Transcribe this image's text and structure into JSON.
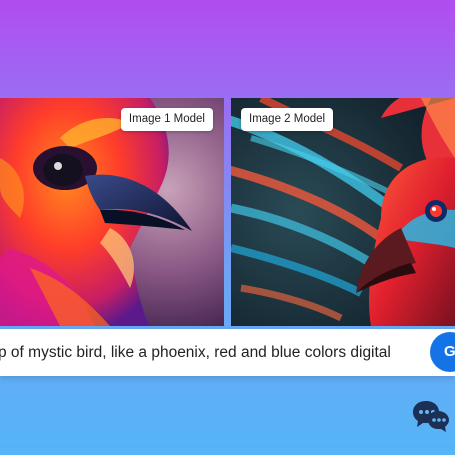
{
  "cards": [
    {
      "label": "Image 1 Model"
    },
    {
      "label": "Image 2 Model"
    }
  ],
  "prompt": {
    "text": "p of mystic bird, like a phoenix, red and blue colors digital",
    "button_label": "G"
  },
  "icons": {
    "chat": "chat-bubbles-icon"
  },
  "colors": {
    "accent": "#1473e6"
  }
}
